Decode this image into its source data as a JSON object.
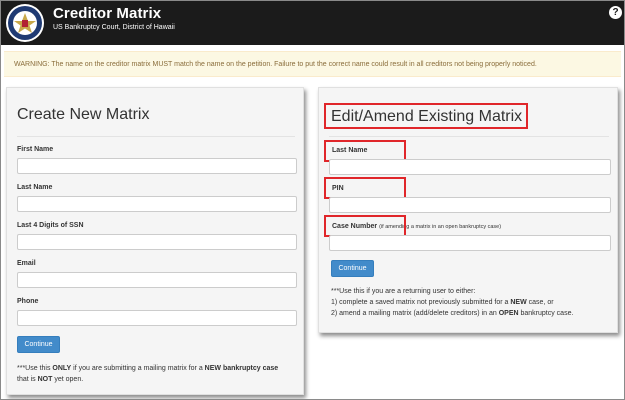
{
  "header": {
    "title": "Creditor Matrix",
    "subtitle": "US Bankruptcy Court, District of Hawaii",
    "help_icon": "question-circle-icon"
  },
  "warning": {
    "text": "WARNING: The name on the creditor matrix MUST match the name on the petition. Failure to put the correct name could result in all creditors not being properly noticed."
  },
  "create_panel": {
    "title": "Create New Matrix",
    "fields": {
      "first_name": {
        "label": "First Name",
        "value": ""
      },
      "last_name": {
        "label": "Last Name",
        "value": ""
      },
      "ssn": {
        "label": "Last 4 Digits of SSN",
        "value": ""
      },
      "email": {
        "label": "Email",
        "value": ""
      },
      "phone": {
        "label": "Phone",
        "value": ""
      }
    },
    "continue_label": "Continue",
    "note": {
      "p1": "***Use this ",
      "b1": "ONLY",
      "p2": " if you are submitting a mailing matrix for a ",
      "b2": "NEW bankruptcy case",
      "p3": "that is ",
      "b3": "NOT",
      "p4": " yet open."
    }
  },
  "edit_panel": {
    "title": "Edit/Amend Existing Matrix",
    "fields": {
      "last_name": {
        "label": "Last Name",
        "value": ""
      },
      "pin": {
        "label": "PIN",
        "value": ""
      },
      "case_number": {
        "label": "Case Number",
        "note": "(if amending a matrix in an open bankruptcy case)",
        "value": ""
      }
    },
    "continue_label": "Continue",
    "note": {
      "line1": "***Use this if you are a returning user to either:",
      "l2a": "1) complete a saved matrix not previously submitted for a ",
      "l2b": "NEW",
      "l2c": " case, or",
      "l3a": "2) amend a mailing matrix (add/delete creditors) in an ",
      "l3b": "OPEN",
      "l3c": " bankruptcy case."
    }
  },
  "colors": {
    "header_bg": "#1b1b1b",
    "warning_bg": "#fcf8e3",
    "warning_text": "#8a6d3b",
    "button": "#428bca",
    "highlight": "#e0262a"
  }
}
